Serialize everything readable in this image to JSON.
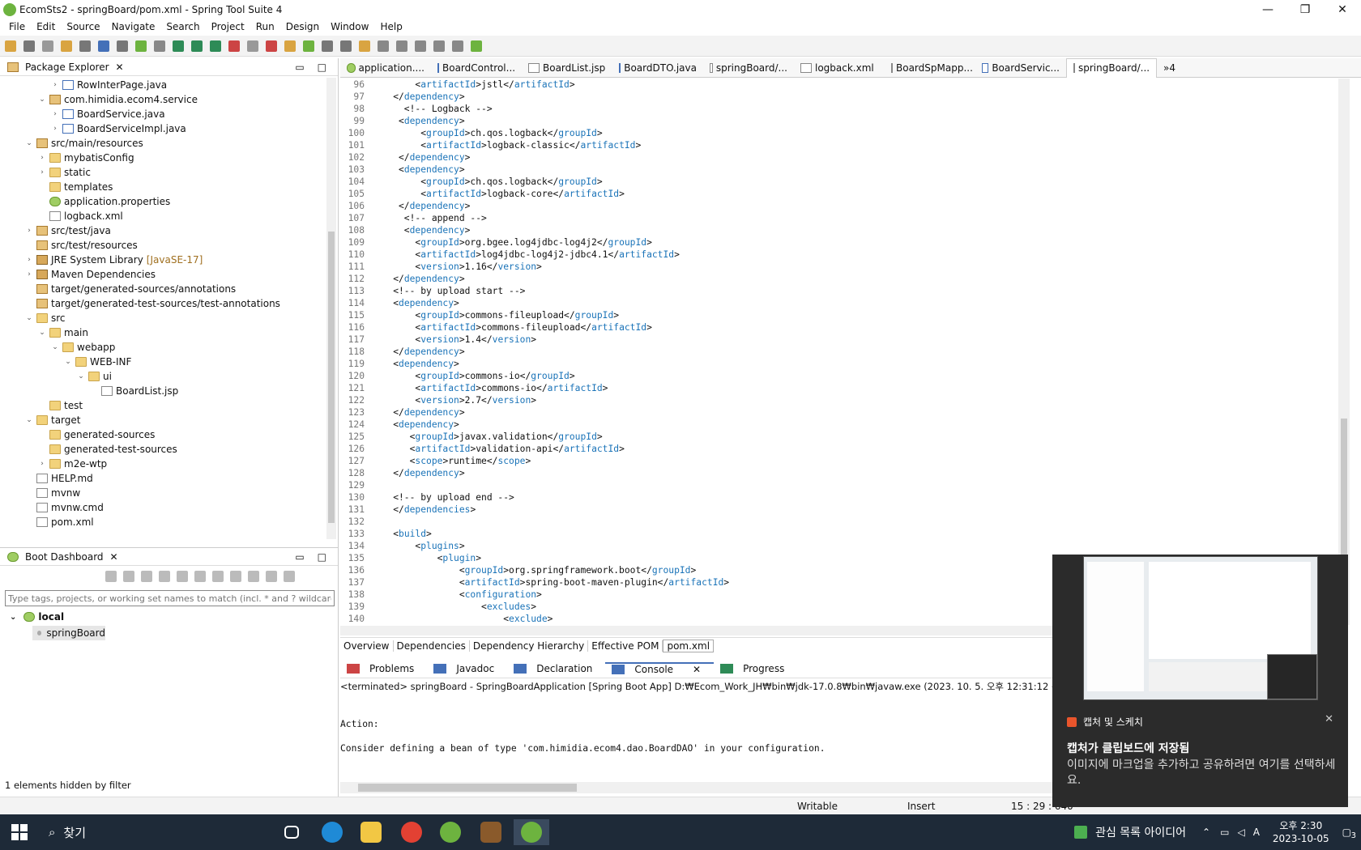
{
  "window": {
    "title": "EcomSts2 - springBoard/pom.xml - Spring Tool Suite 4",
    "min": "—",
    "max": "❐",
    "close": "✕"
  },
  "menu": [
    "File",
    "Edit",
    "Source",
    "Navigate",
    "Search",
    "Project",
    "Run",
    "Design",
    "Window",
    "Help"
  ],
  "package_explorer": {
    "title": "Package Explorer",
    "close": "✕",
    "rows": [
      {
        "d": 3,
        "a": "›",
        "i": "java",
        "t": "RowInterPage.java"
      },
      {
        "d": 2,
        "a": "⌄",
        "i": "pkg",
        "t": "com.himidia.ecom4.service"
      },
      {
        "d": 3,
        "a": "›",
        "i": "java",
        "t": "BoardService.java"
      },
      {
        "d": 3,
        "a": "›",
        "i": "java",
        "t": "BoardServiceImpl.java"
      },
      {
        "d": 1,
        "a": "⌄",
        "i": "pkg",
        "t": "src/main/resources"
      },
      {
        "d": 2,
        "a": "›",
        "i": "folder",
        "t": "mybatisConfig"
      },
      {
        "d": 2,
        "a": "›",
        "i": "folder",
        "t": "static"
      },
      {
        "d": 2,
        "a": "",
        "i": "folder",
        "t": "templates"
      },
      {
        "d": 2,
        "a": "",
        "i": "leaf",
        "t": "application.properties"
      },
      {
        "d": 2,
        "a": "",
        "i": "file",
        "t": "logback.xml"
      },
      {
        "d": 1,
        "a": "›",
        "i": "pkg",
        "t": "src/test/java"
      },
      {
        "d": 1,
        "a": "",
        "i": "pkg",
        "t": "src/test/resources"
      },
      {
        "d": 1,
        "a": "›",
        "i": "lib",
        "t": "JRE System Library",
        "s": "[JavaSE-17]"
      },
      {
        "d": 1,
        "a": "›",
        "i": "lib",
        "t": "Maven Dependencies"
      },
      {
        "d": 1,
        "a": "",
        "i": "pkg",
        "t": "target/generated-sources/annotations"
      },
      {
        "d": 1,
        "a": "",
        "i": "pkg",
        "t": "target/generated-test-sources/test-annotations"
      },
      {
        "d": 1,
        "a": "⌄",
        "i": "folder",
        "t": "src"
      },
      {
        "d": 2,
        "a": "⌄",
        "i": "folder",
        "t": "main"
      },
      {
        "d": 3,
        "a": "⌄",
        "i": "folder",
        "t": "webapp"
      },
      {
        "d": 4,
        "a": "⌄",
        "i": "folder",
        "t": "WEB-INF"
      },
      {
        "d": 5,
        "a": "⌄",
        "i": "folder",
        "t": "ui"
      },
      {
        "d": 6,
        "a": "",
        "i": "file",
        "t": "BoardList.jsp"
      },
      {
        "d": 2,
        "a": "",
        "i": "folder",
        "t": "test"
      },
      {
        "d": 1,
        "a": "⌄",
        "i": "folder",
        "t": "target"
      },
      {
        "d": 2,
        "a": "",
        "i": "folder",
        "t": "generated-sources"
      },
      {
        "d": 2,
        "a": "",
        "i": "folder",
        "t": "generated-test-sources"
      },
      {
        "d": 2,
        "a": "›",
        "i": "folder",
        "t": "m2e-wtp"
      },
      {
        "d": 1,
        "a": "",
        "i": "file",
        "t": "HELP.md"
      },
      {
        "d": 1,
        "a": "",
        "i": "file",
        "t": "mvnw"
      },
      {
        "d": 1,
        "a": "",
        "i": "file",
        "t": "mvnw.cmd"
      },
      {
        "d": 1,
        "a": "",
        "i": "file",
        "t": "pom.xml"
      }
    ]
  },
  "boot_dashboard": {
    "title": "Boot Dashboard",
    "close": "✕",
    "filter_placeholder": "Type tags, projects, or working set names to match (incl. * and ? wildcards)",
    "local": "local",
    "app": "springBoard",
    "footer": "1 elements hidden by filter"
  },
  "editor_tabs": [
    "application....",
    "BoardControl...",
    "BoardList.jsp",
    "BoardDTO.java",
    "springBoard/...",
    "logback.xml",
    "BoardSpMapp...",
    "BoardServic...",
    "springBoard/..."
  ],
  "editor_overflow": "»4",
  "code_lines": [
    {
      "n": "96",
      "t": "        <artifactId>jstl</artifactId>"
    },
    {
      "n": "97",
      "t": "    </dependency>"
    },
    {
      "n": "98",
      "t": "      <!-- Logback -->"
    },
    {
      "n": "99",
      "t": "     <dependency>"
    },
    {
      "n": "100",
      "t": "         <groupId>ch.qos.logback</groupId>"
    },
    {
      "n": "101",
      "t": "         <artifactId>logback-classic</artifactId>"
    },
    {
      "n": "102",
      "t": "     </dependency>"
    },
    {
      "n": "103",
      "t": "     <dependency>"
    },
    {
      "n": "104",
      "t": "         <groupId>ch.qos.logback</groupId>"
    },
    {
      "n": "105",
      "t": "         <artifactId>logback-core</artifactId>"
    },
    {
      "n": "106",
      "t": "     </dependency>"
    },
    {
      "n": "107",
      "t": "      <!-- append -->"
    },
    {
      "n": "108",
      "t": "      <dependency>"
    },
    {
      "n": "109",
      "t": "        <groupId>org.bgee.log4jdbc-log4j2</groupId>"
    },
    {
      "n": "110",
      "t": "        <artifactId>log4jdbc-log4j2-jdbc4.1</artifactId>"
    },
    {
      "n": "111",
      "t": "        <version>1.16</version>"
    },
    {
      "n": "112",
      "t": "    </dependency>"
    },
    {
      "n": "113",
      "t": "    <!-- by upload start -->"
    },
    {
      "n": "114",
      "t": "    <dependency>"
    },
    {
      "n": "115",
      "t": "        <groupId>commons-fileupload</groupId>"
    },
    {
      "n": "116",
      "t": "        <artifactId>commons-fileupload</artifactId>"
    },
    {
      "n": "117",
      "t": "        <version>1.4</version>"
    },
    {
      "n": "118",
      "t": "    </dependency>"
    },
    {
      "n": "119",
      "t": "    <dependency>"
    },
    {
      "n": "120",
      "t": "        <groupId>commons-io</groupId>"
    },
    {
      "n": "121",
      "t": "        <artifactId>commons-io</artifactId>"
    },
    {
      "n": "122",
      "t": "        <version>2.7</version>"
    },
    {
      "n": "123",
      "t": "    </dependency>"
    },
    {
      "n": "124",
      "t": "    <dependency>"
    },
    {
      "n": "125",
      "t": "       <groupId>javax.validation</groupId>"
    },
    {
      "n": "126",
      "t": "       <artifactId>validation-api</artifactId>"
    },
    {
      "n": "127",
      "t": "       <scope>runtime</scope>"
    },
    {
      "n": "128",
      "t": "    </dependency>"
    },
    {
      "n": "129",
      "t": ""
    },
    {
      "n": "130",
      "t": "    <!-- by upload end -->"
    },
    {
      "n": "131",
      "t": "    </dependencies>"
    },
    {
      "n": "132",
      "t": ""
    },
    {
      "n": "133",
      "t": "    <build>"
    },
    {
      "n": "134",
      "t": "        <plugins>"
    },
    {
      "n": "135",
      "t": "            <plugin>"
    },
    {
      "n": "136",
      "t": "                <groupId>org.springframework.boot</groupId>"
    },
    {
      "n": "137",
      "t": "                <artifactId>spring-boot-maven-plugin</artifactId>"
    },
    {
      "n": "138",
      "t": "                <configuration>"
    },
    {
      "n": "139",
      "t": "                    <excludes>"
    },
    {
      "n": "140",
      "t": "                        <exclude>"
    }
  ],
  "pom_tabs": [
    "Overview",
    "Dependencies",
    "Dependency Hierarchy",
    "Effective POM",
    "pom.xml"
  ],
  "console_tabs": [
    "Problems",
    "Javadoc",
    "Declaration",
    "Console",
    "Progress"
  ],
  "console": {
    "terminated": "<terminated> springBoard - SpringBoardApplication [Spring Boot App] D:₩Ecom_Work_JH₩bin₩jdk-17.0.8₩bin₩javaw.exe  (2023. 10. 5. 오후 12:31:12 – 오후 12",
    "lines": [
      "",
      "",
      "Action:",
      "",
      "Consider defining a bean of type 'com.himidia.ecom4.dao.BoardDAO' in your configuration."
    ]
  },
  "status": {
    "writable": "Writable",
    "insert": "Insert",
    "pos": "15 : 29 : 640"
  },
  "taskbar": {
    "search": "찾기",
    "news": "관심 목록 아이디어",
    "time": "오후 2:30",
    "date": "2023-10-05",
    "notif_count": "3"
  },
  "notification": {
    "app": "캡처 및 스케치",
    "close": "✕",
    "heading": "캡처가 클립보드에 저장됨",
    "body": "이미지에 마크업을 추가하고 공유하려면 여기를 선택하세요."
  }
}
